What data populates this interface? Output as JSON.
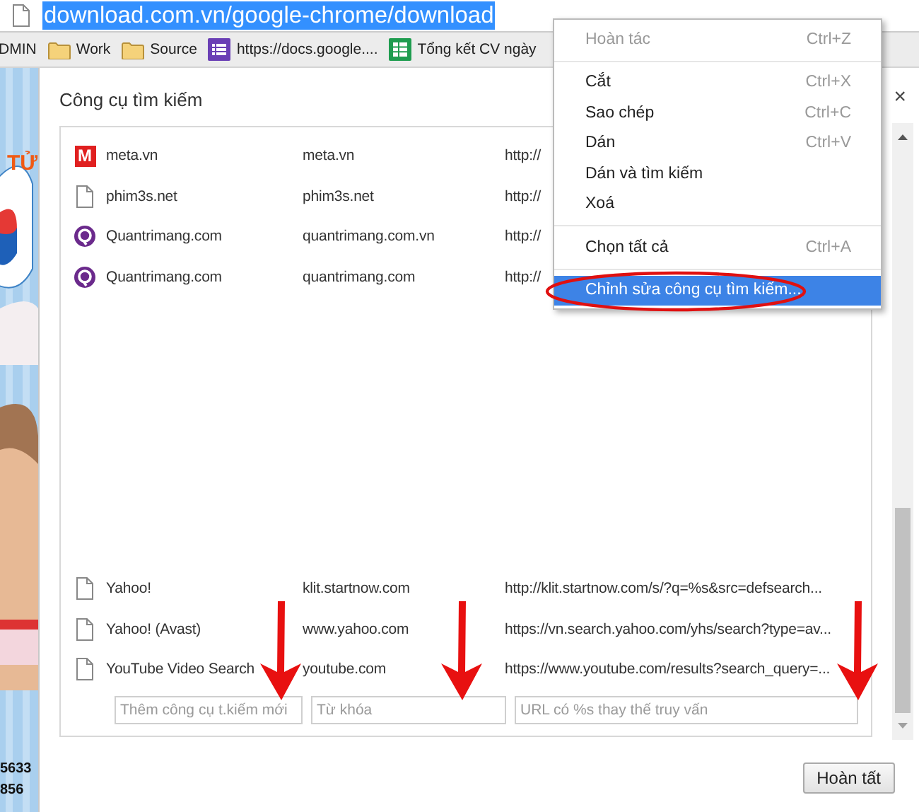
{
  "address_bar": {
    "url": "download.com.vn/google-chrome/download",
    "selected": true
  },
  "bookmarks": [
    {
      "label": "DMIN",
      "kind": "plain"
    },
    {
      "label": "Work",
      "kind": "folder"
    },
    {
      "label": "Source",
      "kind": "folder"
    },
    {
      "label": "https://docs.google....",
      "kind": "form"
    },
    {
      "label": "Tổng kết CV ngày",
      "kind": "sheet"
    }
  ],
  "page_behind": {
    "heading": "TỬ",
    "phone_lines": [
      "5633",
      "856"
    ]
  },
  "dialog": {
    "title": "Công cụ tìm kiếm",
    "close": "×",
    "engines_top": [
      {
        "name": "meta.vn",
        "keyword": "meta.vn",
        "url": "http://",
        "kind": "badge",
        "badge": "M"
      },
      {
        "name": "phim3s.net",
        "keyword": "phim3s.net",
        "url": "http://",
        "kind": "page"
      },
      {
        "name": "Quantrimang.com",
        "keyword": "quantrimang.com.vn",
        "url": "http://",
        "kind": "ring"
      },
      {
        "name": "Quantrimang.com",
        "keyword": "quantrimang.com",
        "url": "http://",
        "kind": "ring"
      }
    ],
    "engines_bottom": [
      {
        "name": "Yahoo!",
        "keyword": "klit.startnow.com",
        "url": "http://klit.startnow.com/s/?q=%s&src=defsearch...",
        "kind": "page"
      },
      {
        "name": "Yahoo! (Avast)",
        "keyword": "www.yahoo.com",
        "url": "https://vn.search.yahoo.com/yhs/search?type=av...",
        "kind": "page"
      },
      {
        "name": "YouTube Video Search",
        "keyword": "youtube.com",
        "url": "https://www.youtube.com/results?search_query=...",
        "kind": "page"
      }
    ],
    "new_engine": {
      "name_placeholder": "Thêm công cụ t.kiếm mới",
      "keyword_placeholder": "Từ khóa",
      "url_placeholder": "URL có %s thay thế truy vấn"
    },
    "done_button": "Hoàn tất"
  },
  "context_menu": [
    {
      "kind": "item",
      "label": "Hoàn tác",
      "shortcut": "Ctrl+Z",
      "disabled": true,
      "selected": false
    },
    {
      "kind": "separator"
    },
    {
      "kind": "item",
      "label": "Cắt",
      "shortcut": "Ctrl+X",
      "disabled": false,
      "selected": false
    },
    {
      "kind": "item",
      "label": "Sao chép",
      "shortcut": "Ctrl+C",
      "disabled": false,
      "selected": false
    },
    {
      "kind": "item",
      "label": "Dán",
      "shortcut": "Ctrl+V",
      "disabled": false,
      "selected": false
    },
    {
      "kind": "item",
      "label": "Dán và tìm kiếm",
      "disabled": false,
      "selected": false
    },
    {
      "kind": "item",
      "label": "Xoá",
      "disabled": false,
      "selected": false
    },
    {
      "kind": "separator"
    },
    {
      "kind": "item",
      "label": "Chọn tất cả",
      "shortcut": "Ctrl+A",
      "disabled": false,
      "selected": false
    },
    {
      "kind": "separator"
    },
    {
      "kind": "item",
      "label": "Chỉnh sửa công cụ tìm kiếm...",
      "disabled": false,
      "selected": true
    }
  ]
}
